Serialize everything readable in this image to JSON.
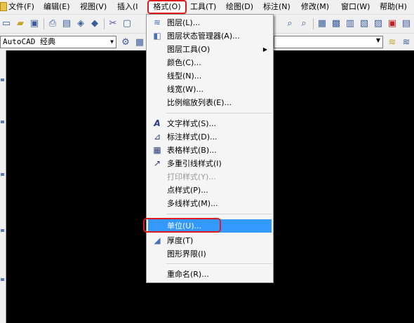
{
  "menubar": {
    "items": [
      {
        "label": "文件(F)"
      },
      {
        "label": "编辑(E)"
      },
      {
        "label": "视图(V)"
      },
      {
        "label": "插入(I"
      },
      {
        "label": "格式(O)"
      },
      {
        "label": "工具(T)"
      },
      {
        "label": "绘图(D)"
      },
      {
        "label": "标注(N)"
      },
      {
        "label": "修改(M)"
      },
      {
        "label": "窗口(W)"
      },
      {
        "label": "帮助(H)"
      }
    ]
  },
  "workspace": {
    "value": "AutoCAD 经典"
  },
  "format_menu": {
    "items": [
      {
        "label": "图层(L)...",
        "icon": "layers-icon"
      },
      {
        "label": "图层状态管理器(A)...",
        "icon": "layer-state-icon"
      },
      {
        "label": "图层工具(O)"
      },
      {
        "label": "颜色(C)..."
      },
      {
        "label": "线型(N)..."
      },
      {
        "label": "线宽(W)..."
      },
      {
        "label": "比例缩放列表(E)..."
      },
      {
        "label": "文字样式(S)...",
        "icon": "text-style-icon"
      },
      {
        "label": "标注样式(D)...",
        "icon": "dim-style-icon"
      },
      {
        "label": "表格样式(B)...",
        "icon": "table-style-icon"
      },
      {
        "label": "多重引线样式(I)",
        "icon": "mleader-style-icon"
      },
      {
        "label": "打印样式(Y)...",
        "disabled": true
      },
      {
        "label": "点样式(P)..."
      },
      {
        "label": "多线样式(M)..."
      },
      {
        "label": "单位(U)...",
        "highlighted": true
      },
      {
        "label": "厚度(T)",
        "icon": "thickness-icon"
      },
      {
        "label": "图形界限(I)"
      },
      {
        "label": "重命名(R)..."
      }
    ]
  },
  "colors": {
    "highlight": "#3399ff",
    "annotation": "#e01a1a",
    "canvas": "#000000"
  }
}
